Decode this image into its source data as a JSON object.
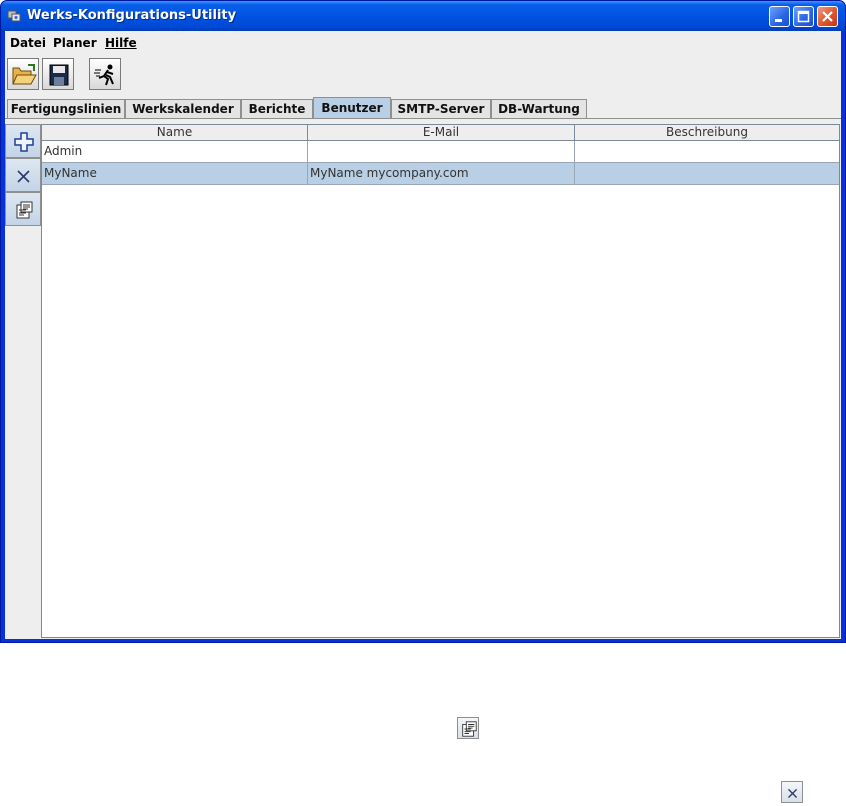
{
  "window": {
    "title": "Werks-Konfigurations-Utility"
  },
  "menu": [
    {
      "label": "Datei"
    },
    {
      "label": "Planer"
    },
    {
      "label": "Hilfe"
    }
  ],
  "toolbar": [
    {
      "icon": "open-folder-icon"
    },
    {
      "icon": "save-disk-icon"
    },
    {
      "icon": "run-icon"
    }
  ],
  "tabs": [
    {
      "label": "Fertigungslinien"
    },
    {
      "label": "Werkskalender"
    },
    {
      "label": "Berichte"
    },
    {
      "label": "Benutzer",
      "active": true
    },
    {
      "label": "SMTP-Server"
    },
    {
      "label": "DB-Wartung"
    }
  ],
  "side_buttons": [
    {
      "icon": "add-icon"
    },
    {
      "icon": "delete-icon"
    },
    {
      "icon": "properties-icon"
    }
  ],
  "table": {
    "columns": [
      "Name",
      "E-Mail",
      "Beschreibung"
    ],
    "rows": [
      {
        "name": "Admin",
        "email": "",
        "description": ""
      },
      {
        "name": "MyName",
        "email": "MyName mycompany.com",
        "description": "",
        "selected": true
      }
    ]
  },
  "loose_icons": [
    {
      "icon": "properties-icon"
    },
    {
      "icon": "delete-icon"
    }
  ],
  "colors": {
    "titlebar": "#0054e3",
    "selection": "#b8cfe5",
    "active_tab": "#b8cfe5"
  }
}
